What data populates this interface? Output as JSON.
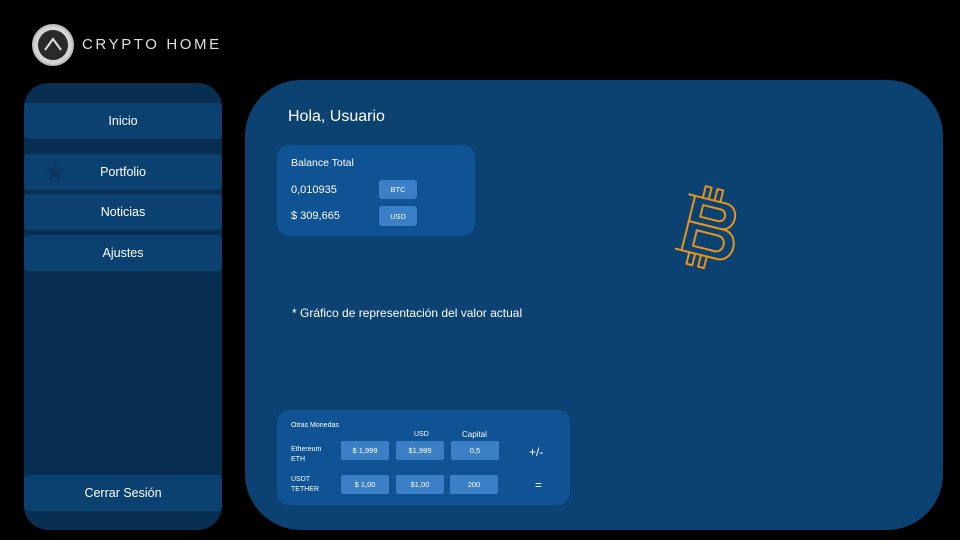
{
  "app": {
    "title": "CRYPTO HOME",
    "logo_icon": "triangle-logo-icon"
  },
  "sidebar": {
    "items": [
      {
        "label": "Inicio"
      },
      {
        "label": "Portfolio",
        "icon": "star-icon",
        "selected": true
      },
      {
        "label": "Noticias"
      },
      {
        "label": "Ajustes"
      }
    ],
    "logout_label": "Cerrar Sesión"
  },
  "main": {
    "greeting": "Hola, Usuario",
    "balance": {
      "title": "Balance Total",
      "btc_value": "0,010935",
      "btc_unit": "BTC",
      "usd_value": "$ 309,665",
      "usd_unit": "USD"
    },
    "chart_note": "* Gráfico de representación del valor actual",
    "hero_icon": "bitcoin-icon",
    "other_coins": {
      "title": "Otras Monedas",
      "headers": {
        "usd": "USD",
        "capital": "Capital"
      },
      "rows": [
        {
          "name": "Ethereum",
          "symbol": "ETH",
          "price": "$ 1,999",
          "usd": "$1,999",
          "capital": "0,5",
          "action": "+/-"
        },
        {
          "name": "USDT",
          "symbol": "TETHER",
          "price": "$ 1,00",
          "usd": "$1,00",
          "capital": "200",
          "action": "="
        }
      ]
    }
  },
  "colors": {
    "background": "#000000",
    "sidebar": "#082e52",
    "nav_item": "#0a4170",
    "main_panel": "#0b4272",
    "card": "#0f5394",
    "pill": "#3b7fc6",
    "bitcoin_outline": "#e8941a",
    "star": "#0e3760"
  }
}
